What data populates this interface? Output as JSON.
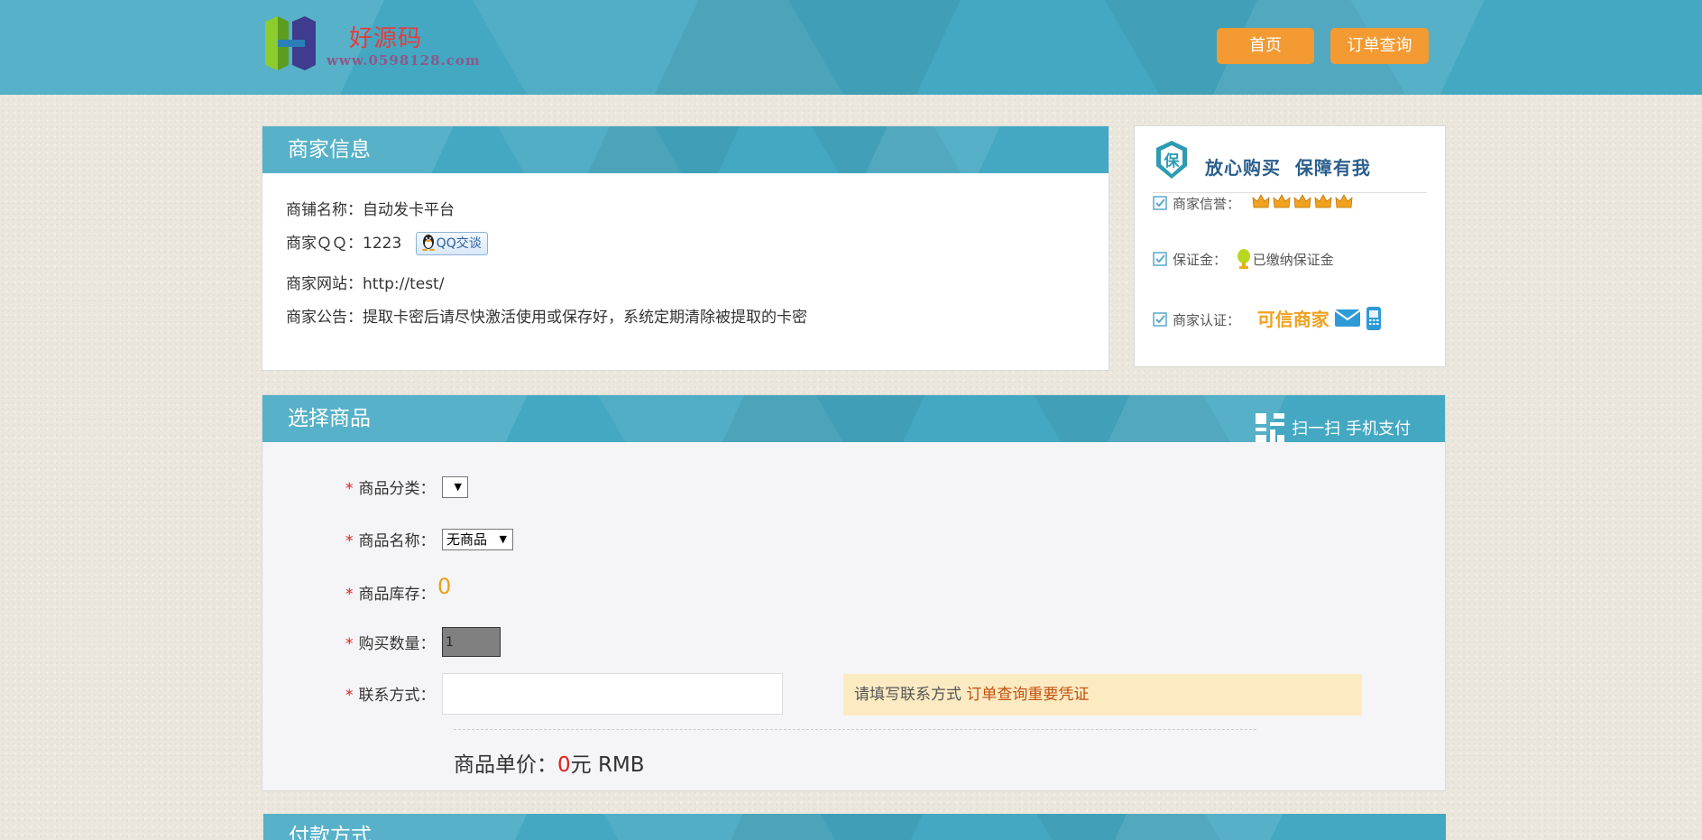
{
  "header": {
    "logo_text": "好源码",
    "logo_url": "www.0598128.com",
    "nav": {
      "home": "首页",
      "order_query": "订单查询"
    }
  },
  "merchant_info": {
    "title": "商家信息",
    "shop_name_label": "商铺名称：",
    "shop_name": "自动发卡平台",
    "qq_label": "商家ＱＱ：",
    "qq": "1223",
    "qq_button": "QQ交谈",
    "website_label": "商家网站：",
    "website": "http://test/",
    "notice_label": "商家公告：",
    "notice": "提取卡密后请尽快激活使用或保存好，系统定期清除被提取的卡密"
  },
  "guarantee": {
    "badge": "保",
    "title": "放心购买  保障有我",
    "reputation_label": "商家信誉：",
    "deposit_label": "保证金：",
    "deposit_value": "已缴纳保证金",
    "certify_label": "商家认证：",
    "certify_value": "可信商家"
  },
  "select_goods": {
    "title": "选择商品",
    "scan_label": "扫一扫 手机支付",
    "required_mark": "*",
    "category_label": "商品分类：",
    "category_value": "",
    "name_label": "商品名称：",
    "name_value": "无商品",
    "stock_label": "商品库存：",
    "stock_value": "0",
    "qty_label": "购买数量：",
    "qty_value": "1",
    "contact_label": "联系方式：",
    "contact_value": "",
    "tip_prefix": "请填写联系方式 ",
    "tip_highlight": "订单查询重要凭证",
    "price_label": "商品单价：",
    "price_value": "0",
    "price_unit": "元 RMB"
  },
  "payment": {
    "title": "付款方式"
  },
  "colors": {
    "teal": "#44a8c2",
    "orange_button": "#f39a33",
    "stock_orange": "#e8a21a",
    "red": "#dd2222",
    "tip_bg": "#fcebc2"
  },
  "icons": [
    "logo-mark",
    "penguin-icon",
    "shield-badge-icon",
    "check-icon",
    "crown-icon",
    "trophy-icon",
    "mail-icon",
    "phone-icon",
    "qr-code-icon",
    "dropdown-arrow-icon"
  ]
}
